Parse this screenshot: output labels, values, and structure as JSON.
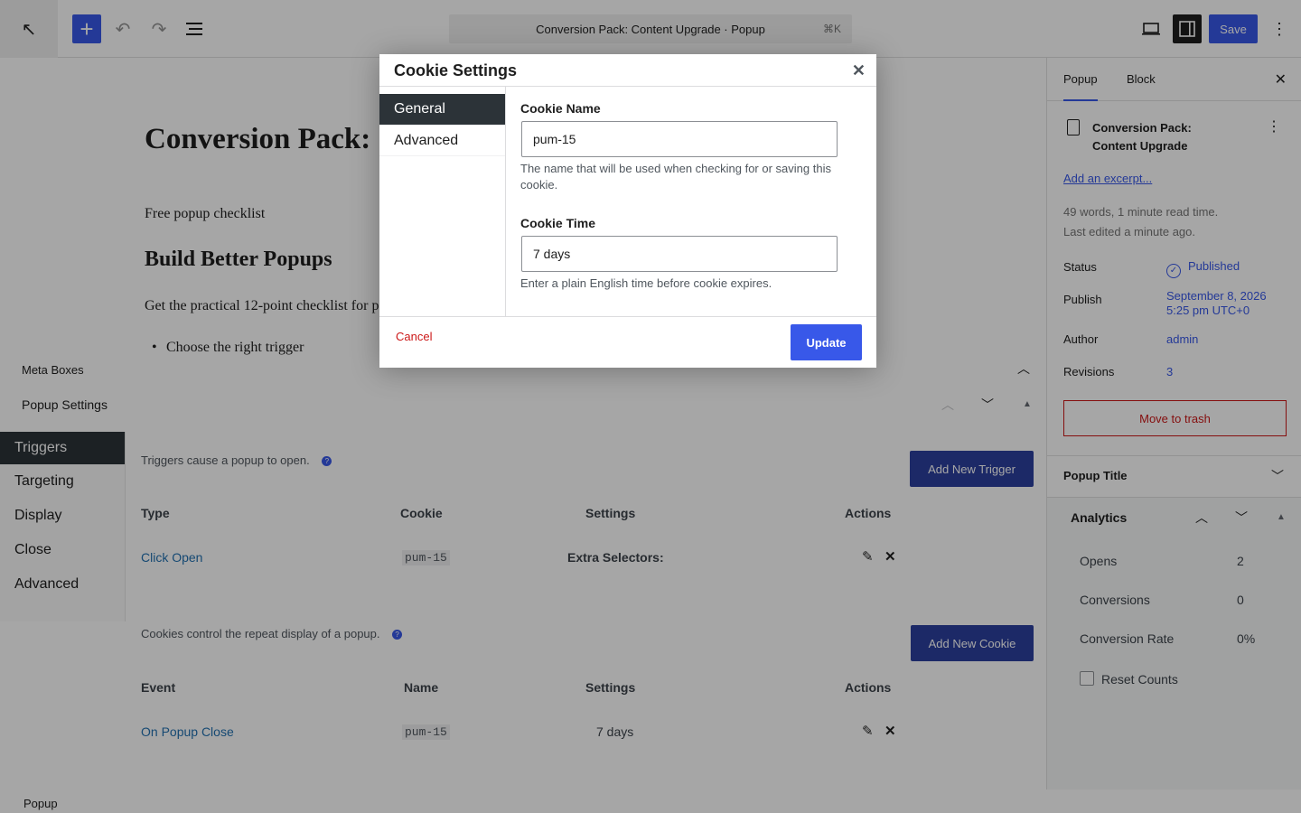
{
  "toolbar": {
    "back_icon": "arrow-up-left-icon",
    "add_icon": "plus-icon",
    "undo_icon": "undo-icon",
    "redo_icon": "redo-icon",
    "list_view_icon": "list-view-icon",
    "document_title": "Conversion Pack: Content Upgrade · Popup",
    "shortcut": "⌘K",
    "view_icon": "desktop-icon",
    "settings_icon": "sidebar-icon",
    "save_label": "Save",
    "more_icon": "kebab-icon"
  },
  "canvas": {
    "post_title": "Conversion Pack: C",
    "paragraph_1": "Free popup checklist",
    "heading_2": "Build Better Popups",
    "paragraph_2": "Get the practical 12-point checklist for p",
    "list_item_1": "Choose the right trigger"
  },
  "meta_boxes": {
    "label": "Meta Boxes",
    "popup_settings_title": "Popup Settings",
    "tabs": [
      "Triggers",
      "Targeting",
      "Display",
      "Close",
      "Advanced"
    ],
    "active_tab": "Triggers",
    "triggers": {
      "description": "Triggers cause a popup to open.",
      "add_button": "Add New Trigger",
      "headers": [
        "Type",
        "Cookie",
        "Settings",
        "Actions"
      ],
      "rows": [
        {
          "type": "Click Open",
          "cookie": "pum-15",
          "settings": "Extra Selectors:"
        }
      ]
    },
    "cookies": {
      "description": "Cookies control the repeat display of a popup.",
      "add_button": "Add New Cookie",
      "headers": [
        "Event",
        "Name",
        "Settings",
        "Actions"
      ],
      "rows": [
        {
          "event": "On Popup Close",
          "name": "pum-15",
          "settings": "7 days"
        }
      ]
    },
    "help_glyph": "?"
  },
  "footer_breadcrumb": "Popup",
  "sidebar": {
    "tabs": [
      "Popup",
      "Block"
    ],
    "active_tab": "Popup",
    "doc_title": "Conversion Pack: Content Upgrade",
    "excerpt_link": "Add an excerpt...",
    "stats_line_1": "49 words, 1 minute read time.",
    "stats_line_2": "Last edited a minute ago.",
    "status_label": "Status",
    "status_value": "Published",
    "publish_label": "Publish",
    "publish_value": "September 8, 2026 5:25 pm UTC+0",
    "author_label": "Author",
    "author_value": "admin",
    "revisions_label": "Revisions",
    "revisions_value": "3",
    "trash_button": "Move to trash",
    "popup_title_panel": "Popup Title",
    "analytics": {
      "title": "Analytics",
      "rows": [
        {
          "label": "Opens",
          "value": "2"
        },
        {
          "label": "Conversions",
          "value": "0"
        },
        {
          "label": "Conversion Rate",
          "value": "0%"
        }
      ],
      "reset_label": "Reset Counts"
    }
  },
  "modal": {
    "title": "Cookie Settings",
    "nav": [
      "General",
      "Advanced"
    ],
    "active_nav": "General",
    "cookie_name_label": "Cookie Name",
    "cookie_name_value": "pum-15",
    "cookie_name_help": "The name that will be used when checking for or saving this cookie.",
    "cookie_time_label": "Cookie Time",
    "cookie_time_value": "7 days",
    "cookie_time_help": "Enter a plain English time before cookie expires.",
    "cancel_label": "Cancel",
    "update_label": "Update"
  },
  "colors": {
    "accent": "#3858e9",
    "dark_tab": "#2c3338",
    "danger": "#cc1818",
    "button_dimmed": "#2c3f9e"
  }
}
